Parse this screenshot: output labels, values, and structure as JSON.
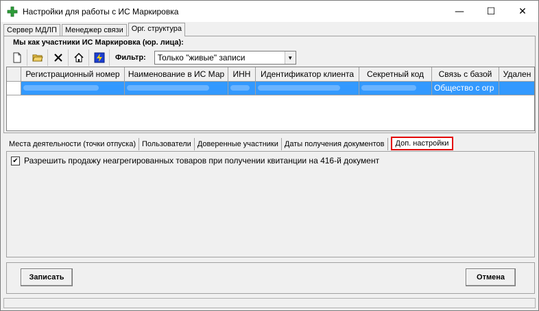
{
  "window": {
    "title": "Настройки для работы с ИС Маркировка",
    "minimize_glyph": "—",
    "maximize_glyph": "☐",
    "close_glyph": "✕"
  },
  "top_tabs": [
    {
      "label": "Сервер МДЛП"
    },
    {
      "label": "Менеджер связи"
    },
    {
      "label": "Орг. структура"
    }
  ],
  "group": {
    "label": "Мы как участники ИС Маркировка (юр. лица):"
  },
  "toolbar": {
    "icons": [
      "new-document-icon",
      "open-folder-icon",
      "delete-x-icon",
      "home-icon",
      "lightning-icon"
    ],
    "filter_label": "Фильтр:",
    "filter_value": "Только \"живые\" записи"
  },
  "grid": {
    "columns": [
      {
        "label": "Регистрационный номер"
      },
      {
        "label": "Наименование в ИС Мар"
      },
      {
        "label": "ИНН"
      },
      {
        "label": "Идентификатор клиента"
      },
      {
        "label": "Секретный код"
      },
      {
        "label": "Связь с базой"
      },
      {
        "label": "Удален"
      }
    ],
    "rows": [
      {
        "link_base": "Общество с огр"
      }
    ]
  },
  "bottom_tabs": [
    {
      "label": "Места деятельности (точки отпуска)"
    },
    {
      "label": "Пользователи"
    },
    {
      "label": "Доверенные участники"
    },
    {
      "label": "Даты получения документов"
    },
    {
      "label": "Доп. настройки"
    }
  ],
  "settings": {
    "checkbox_label": "Разрешить продажу неагрегированных товаров при получении квитанции на 416-й документ",
    "checked": true
  },
  "buttons": {
    "save": "Записать",
    "cancel": "Отмена"
  },
  "colors": {
    "selection": "#3399ff",
    "active_tab_outline": "#e30000",
    "app_icon": "#2e9e3a"
  }
}
